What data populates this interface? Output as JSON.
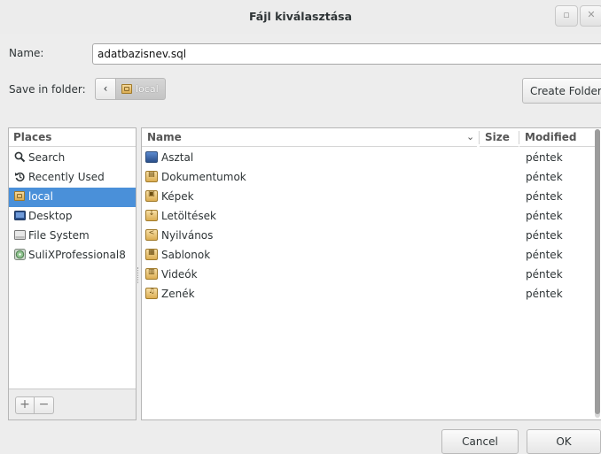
{
  "window": {
    "title": "Fájl kiválasztása",
    "maximize_icon": "maximize-icon",
    "close_icon": "close-icon"
  },
  "name_row": {
    "label": "Name:",
    "value": "adatbazisnev.sql"
  },
  "folder_row": {
    "label": "Save in folder:",
    "back_glyph": "‹",
    "current_folder": "local",
    "create_folder_label": "Create Folder"
  },
  "places": {
    "header": "Places",
    "items": [
      {
        "label": "Search",
        "icon": "search-icon",
        "selected": false
      },
      {
        "label": "Recently Used",
        "icon": "history-icon",
        "selected": false
      },
      {
        "label": "local",
        "icon": "home-folder-icon",
        "selected": true
      },
      {
        "label": "Desktop",
        "icon": "desktop-icon",
        "selected": false
      },
      {
        "label": "File System",
        "icon": "drive-icon",
        "selected": false
      },
      {
        "label": "SuliXProfessional8",
        "icon": "disc-icon",
        "selected": false
      }
    ],
    "add_label": "+",
    "remove_label": "−"
  },
  "files": {
    "columns": {
      "name": "Name",
      "size": "Size",
      "modified": "Modified"
    },
    "rows": [
      {
        "name": "Asztal",
        "icon": "desktop-folder-icon",
        "modified": "péntek"
      },
      {
        "name": "Dokumentumok",
        "icon": "documents-folder-icon",
        "modified": "péntek"
      },
      {
        "name": "Képek",
        "icon": "pictures-folder-icon",
        "modified": "péntek"
      },
      {
        "name": "Letöltések",
        "icon": "downloads-folder-icon",
        "modified": "péntek"
      },
      {
        "name": "Nyilvános",
        "icon": "public-folder-icon",
        "modified": "péntek"
      },
      {
        "name": "Sablonok",
        "icon": "templates-folder-icon",
        "modified": "péntek"
      },
      {
        "name": "Videók",
        "icon": "videos-folder-icon",
        "modified": "péntek"
      },
      {
        "name": "Zenék",
        "icon": "music-folder-icon",
        "modified": "péntek"
      }
    ]
  },
  "buttons": {
    "cancel": "Cancel",
    "ok": "OK"
  },
  "colors": {
    "selection": "#4a90d9",
    "background": "#ededed"
  }
}
